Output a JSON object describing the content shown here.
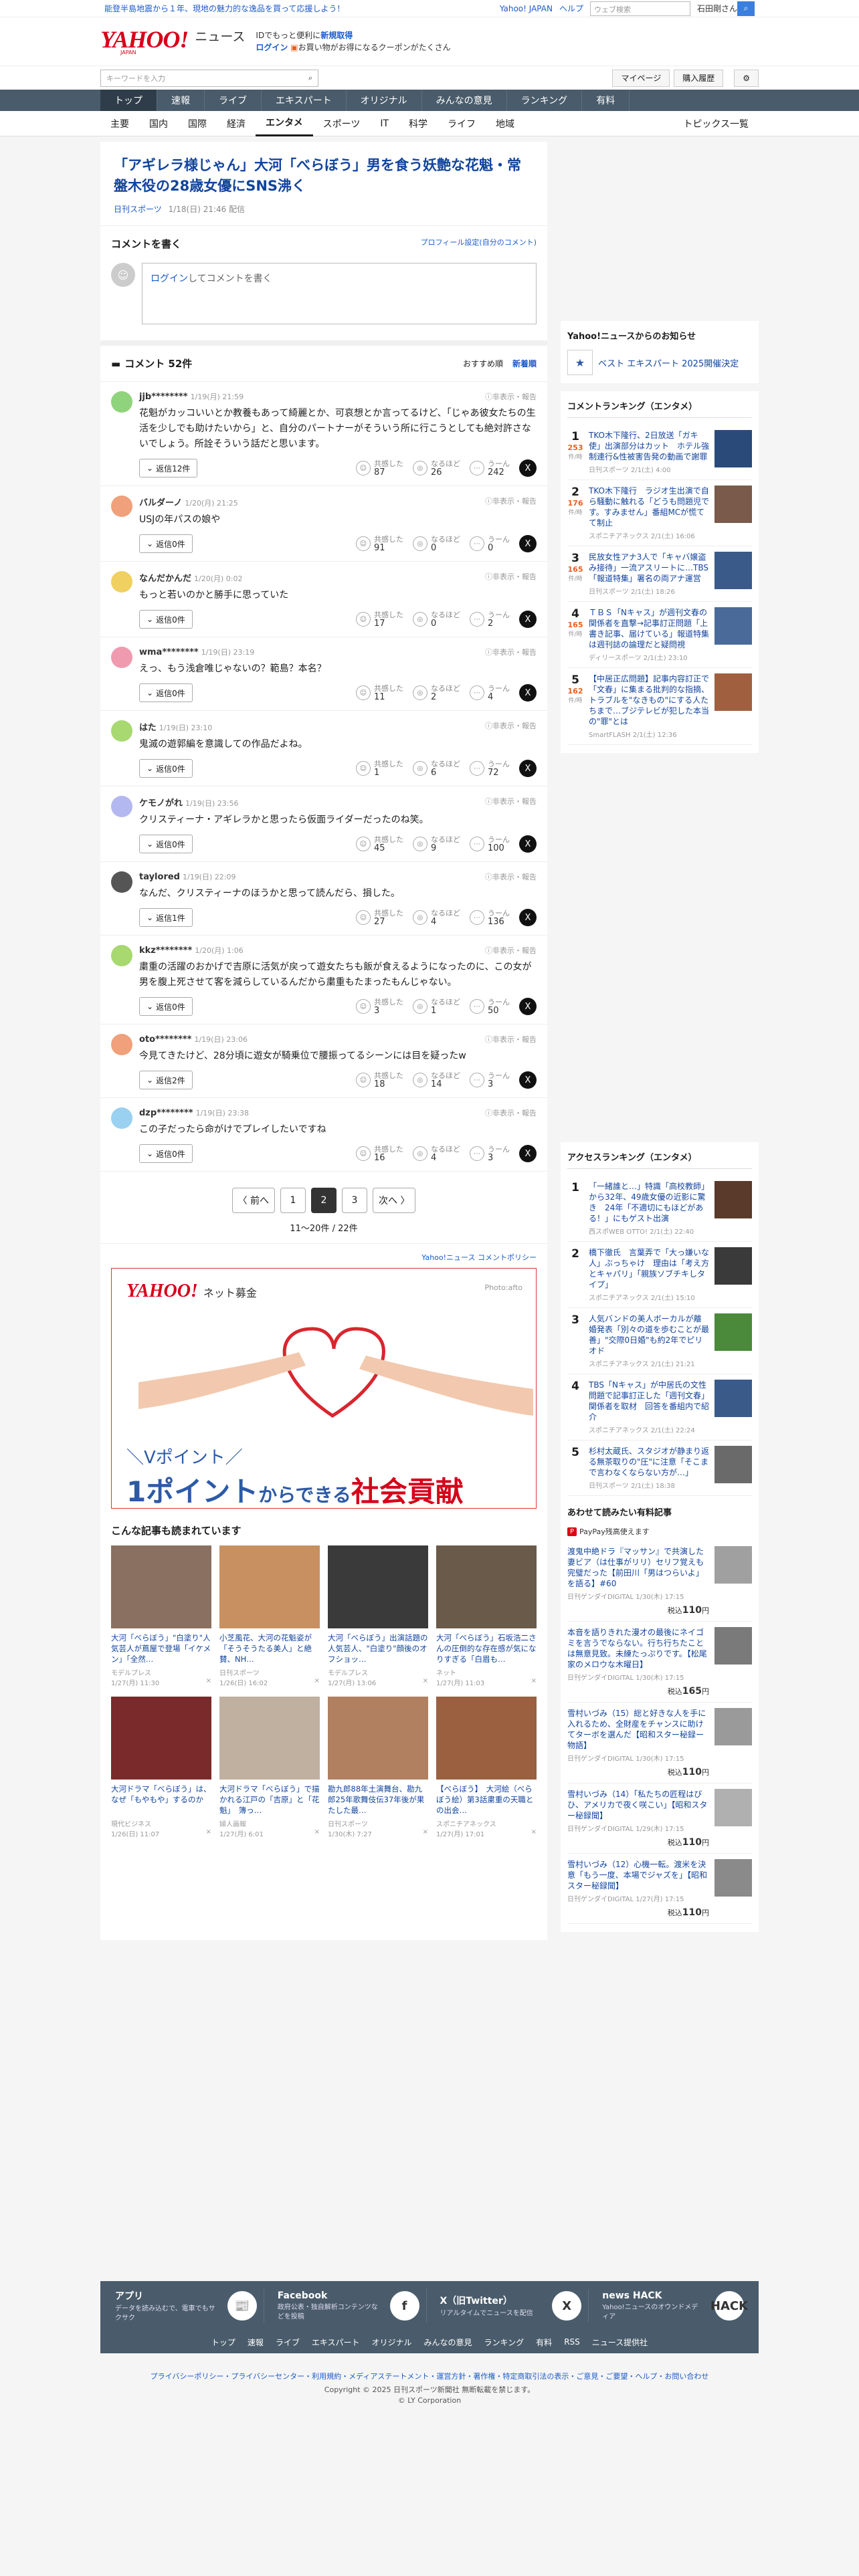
{
  "topbar": {
    "promo": "能登半島地震から１年、現地の魅力的な逸品を買って応援しよう！",
    "links": [
      "Yahoo! JAPAN",
      "ヘルプ"
    ],
    "search_placeholder": "ウェブ検索",
    "user": "石田剛さん"
  },
  "masthead": {
    "logo": "YAHOO!",
    "logo_sub": "JAPAN",
    "section": "ニュース",
    "promo_line1_pre": "IDでもっと便利に",
    "promo_line1_link": "新規取得",
    "promo_line2_link": "ログイン",
    "promo_line2_text": "お買い物がお得になるクーポンがたくさん"
  },
  "toolrow": {
    "keyword_placeholder": "キーワードを入力",
    "mypage": "マイページ",
    "history": "購入履歴"
  },
  "nav": [
    "トップ",
    "速報",
    "ライブ",
    "エキスパート",
    "オリジナル",
    "みんなの意見",
    "ランキング",
    "有料"
  ],
  "subnav": [
    "主要",
    "国内",
    "国際",
    "経済",
    "エンタメ",
    "スポーツ",
    "IT",
    "科学",
    "ライフ",
    "地域"
  ],
  "subnav_right": "トピックス一覧",
  "article": {
    "title": "「アギレラ様じゃん」大河「べらぼう」男を食う妖艶な花魁・常盤木役の28歳女優にSNS沸く",
    "source": "日刊スポーツ",
    "date": "1/18(日) 21:46 配信"
  },
  "comment_write": {
    "title": "コメントを書く",
    "profile_link": "プロフィール設定(自分のコメント)",
    "login": "ログイン",
    "placeholder": "してコメントを書く"
  },
  "comments_header": {
    "title": "コメント 52件",
    "sort_recommended": "おすすめ順",
    "sort_newest": "新着順"
  },
  "labels": {
    "hide_report": "非表示・報告",
    "agree": "共感した",
    "naruhodo": "なるほど",
    "uun": "うーん"
  },
  "comments": [
    {
      "user": "jjb********",
      "date": "1/19(月) 21:59",
      "text": "花魁がカッコいいとか教養もあって綺麗とか、可哀想とか言ってるけど、「じゃあ彼女たちの生活を少しでも助けたいから」と、自分のパートナーがそういう所に行こうとしても絶対許さないでしょう。所詮そういう話だと思います。",
      "reply": "返信12件",
      "agree": "87",
      "naruhodo": "26",
      "uun": "242",
      "color": "#8fd37c"
    },
    {
      "user": "バルダーノ",
      "date": "1/20(月) 21:25",
      "text": "USJの年パスの娘や",
      "reply": "返信0件",
      "agree": "91",
      "naruhodo": "0",
      "uun": "0",
      "color": "#f0a07a"
    },
    {
      "user": "なんだかんだ",
      "date": "1/20(月) 0:02",
      "text": "もっと若いのかと勝手に思っていた",
      "reply": "返信0件",
      "agree": "17",
      "naruhodo": "0",
      "uun": "2",
      "color": "#f0d060"
    },
    {
      "user": "wma********",
      "date": "1/19(日) 23:19",
      "text": "えっ、もう浅倉唯じゃないの？範島？本名？",
      "reply": "返信0件",
      "agree": "11",
      "naruhodo": "2",
      "uun": "4",
      "color": "#f09ab0"
    },
    {
      "user": "はた",
      "date": "1/19(日) 23:10",
      "text": "鬼滅の遊郭編を意識しての作品だよね。",
      "reply": "返信0件",
      "agree": "1",
      "naruhodo": "6",
      "uun": "72",
      "color": "#a8d870"
    },
    {
      "user": "ケモノがれ",
      "date": "1/19(日) 23:56",
      "text": "クリスティーナ・アギレラかと思ったら仮面ライダーだったのね笑。",
      "reply": "返信0件",
      "agree": "45",
      "naruhodo": "9",
      "uun": "100",
      "color": "#b4b8f0"
    },
    {
      "user": "taylored",
      "date": "1/19(日) 22:09",
      "text": "なんだ、クリスティーナのほうかと思って読んだら、損した。",
      "reply": "返信1件",
      "agree": "27",
      "naruhodo": "4",
      "uun": "136",
      "color": "#555555"
    },
    {
      "user": "kkz********",
      "date": "1/20(月) 1:06",
      "text": "粛重の活躍のおかげで吉原に活気が戻って遊女たちも飯が食えるようになったのに、この女が男を腹上死させて客を減らしているんだから粛重もたまったもんじゃない。",
      "reply": "返信0件",
      "agree": "3",
      "naruhodo": "1",
      "uun": "50",
      "color": "#a8d870"
    },
    {
      "user": "oto********",
      "date": "1/19(日) 23:06",
      "text": "今見てきたけど、28分頃に遊女が騎乗位で腰振ってるシーンには目を疑ったw",
      "reply": "返信2件",
      "agree": "18",
      "naruhodo": "14",
      "uun": "3",
      "color": "#f0a07a"
    },
    {
      "user": "dzp********",
      "date": "1/19(日) 23:38",
      "text": "この子だったら命がけでプレイしたいですね",
      "reply": "返信0件",
      "agree": "16",
      "naruhodo": "4",
      "uun": "3",
      "color": "#9ad0f0"
    }
  ],
  "pager": {
    "prev": "〈 前へ",
    "pages": [
      "1",
      "2",
      "3"
    ],
    "current": "2",
    "next": "次へ 〉",
    "info": "11〜20件 / 22件"
  },
  "comment_policy": "Yahoo!ニュース コメントポリシー",
  "ad": {
    "logo": "YAHOO!",
    "label": "ネット募金",
    "photo_credit": "Photo:afto",
    "line1": "＼Vポイント／",
    "line2_a": "1ポイント",
    "line2_b": "からできる",
    "line2_c": "社会貢献"
  },
  "also_read": {
    "title": "こんな記事も読まれています",
    "items": [
      {
        "title": "大河「べらぼう」\"白塗り\"人気芸人が蔦屋で登場「イケメン」「全然…",
        "source": "モデルプレス",
        "date": "1/27(月) 11:30"
      },
      {
        "title": "小芝風花、大河の花魁姿が「そうそうたる美人」と絶賛、NH…",
        "source": "日刊スポーツ",
        "date": "1/26(日) 16:02"
      },
      {
        "title": "大河「べらぼう」出演話題の人気芸人、\"白塗り\"顔後のオフショッ…",
        "source": "モデルプレス",
        "date": "1/27(月) 13:06"
      },
      {
        "title": "大河「べらぼう」石坂浩二さんの圧倒的な存在感が気になりすぎる「白眉も…",
        "source": "ネット",
        "date": "1/27(月) 11:03"
      },
      {
        "title": "大河ドラマ「べらぼう」は、なぜ「もやもや」するのか",
        "source": "現代ビジネス",
        "date": "1/26(日) 11:07"
      },
      {
        "title": "大河ドラマ「べらぼう」で描かれる江戸の「吉原」と「花魁」　簿っ…",
        "source": "婦人画報",
        "date": "1/27(月) 6:01"
      },
      {
        "title": "勘九郎88年土演舞台、勘九郎25年歌舞伎伝37年後が果たした最…",
        "source": "日刊スポーツ",
        "date": "1/30(木) 7:27"
      },
      {
        "title": "【べらぼう】　大河絵（べらぼう絵）第3話粛重の天職との出会…",
        "source": "スポニチアネックス",
        "date": "1/27(月) 17:01"
      }
    ]
  },
  "sidebar": {
    "notice_title": "Yahoo!ニュースからのお知らせ",
    "notice_item": "ベスト エキスパート 2025開催決定",
    "comment_ranking_title": "コメントランキング（エンタメ）",
    "comment_ranking": [
      {
        "rank": "1",
        "count": "253",
        "unit": "件/時",
        "title": "TKO木下隆行、2日放送「ガキ使」出演部分はカット　ホテル強制連行&性被害告発の動画で謝罪",
        "source": "日刊スポーツ 2/1(土) 4:00"
      },
      {
        "rank": "2",
        "count": "176",
        "unit": "件/時",
        "title": "TKO木下隆行　ラジオ生出演で自ら騒動に触れる「どうも問題児です。すみません」番組MCが慌てて制止",
        "source": "スポニチアネックス 2/1(土) 16:06"
      },
      {
        "rank": "3",
        "count": "165",
        "unit": "件/時",
        "title": "民放女性アナ3人で「キャバ嬢盗み接待」一流アスリートに…TBS「報道特集」署名の両アナ運営",
        "source": "日刊スポーツ 2/1(土) 18:26"
      },
      {
        "rank": "4",
        "count": "165",
        "unit": "件/時",
        "title": "ＴＢＳ「Nキャス」が週刊文春の関係者を直撃→記事訂正問題「上書き記事、届けている」報道特集は週刊誌の論理だと疑問視",
        "source": "ディリースポーツ 2/1(土) 23:10"
      },
      {
        "rank": "5",
        "count": "162",
        "unit": "件/時",
        "title": "【中居正広問題】記事内容訂正で「文春」に集まる批判的な指摘、トラブルを\"なきもの\"にする人たちまで…ブジテレビが犯した本当の\"罪\"とは",
        "source": "SmartFLASH 2/1(土) 12:36"
      }
    ],
    "access_ranking_title": "アクセスランキング（エンタメ）",
    "access_ranking": [
      {
        "rank": "1",
        "title": "「一緒誰と…」特識「高校教師」から32年、49歳女優の近影に驚き　24年「不適切にもほどがある！」にもゲスト出演",
        "source": "西スポWEB OTTO! 2/1(土) 22:40"
      },
      {
        "rank": "2",
        "title": "橋下徹氏　言葉弄で「大っ嫌いな人」ぶっちゃけ　理由は「考え方とキャパリ」「親族ソブチキしタイプ」",
        "source": "スポニチアネックス 2/1(土) 15:10"
      },
      {
        "rank": "3",
        "title": "人気バンドの美人ボーカルが離婚発表「別々の道を歩むことが最善」\"交際0日婚\"も約2年でピリオド",
        "source": "スポニチアネックス 2/1(土) 21:21"
      },
      {
        "rank": "4",
        "title": "TBS「Nキャス」が中居氏の文性問題で記事訂正した「週刊文春」関係者を取材　回答を番組内で紹介",
        "source": "スポニチアネックス 2/1(土) 22:24"
      },
      {
        "rank": "5",
        "title": "杉村太蔵氏、スタジオが静まり返る無茶取りの\"圧\"に注意「そこまで言わなくならない方が…」",
        "source": "日刊スポーツ 2/1(土) 18:38"
      }
    ],
    "paid_title": "あわせて読みたい有料記事",
    "paypay": "PayPay残高使えます",
    "paid": [
      {
        "title": "渡鬼中絶ドラ『マッサン』で共演した妻ビア（は仕事がリリ）セリフ覚えも完璧だった【前田川「男はつらいよ」を語る】#60",
        "source": "日刊ゲンダイDIGITAL 1/30(木) 17:15",
        "price": "110"
      },
      {
        "title": "本音を語りきれた漫才の最後にネイゴミを言うでならない。行ち行ちたことは無意見致。未練たっぷりです。【松尾家のメロウな木曜日】",
        "source": "日刊ゲンダイDIGITAL 1/30(木) 17:15",
        "price": "165"
      },
      {
        "title": "雪村いづみ（15）総と好きな人を手に入れるため、全財産をチャンスに助けてターボを選んだ【昭和スター秘録ー物語】",
        "source": "日刊ゲンダイDIGITAL 1/30(木) 17:15",
        "price": "110"
      },
      {
        "title": "雪村いづみ（14）「私たちの匠程はびひ、アメリカで夜く咲こい」【昭和スター秘録聞】",
        "source": "日刊ゲンダイDIGITAL 1/29(木) 17:15",
        "price": "110"
      },
      {
        "title": "雪村いづみ（12）心機一転。渡米を決意「もう一度、本場でジャズを」【昭和スター秘録聞】",
        "source": "日刊ゲンダイDIGITAL 1/27(月) 17:15",
        "price": "110"
      }
    ],
    "price_prefix": "税込",
    "price_suffix": "円"
  },
  "footer": {
    "apps": [
      {
        "title": "アプリ",
        "desc": "データを読み込むで、電車でもサクサク",
        "icon": "📰"
      },
      {
        "title": "Facebook",
        "desc": "政府公表・独自解析コンテンツなどを投稿",
        "icon": "f"
      },
      {
        "title": "X（旧Twitter）",
        "desc": "リアルタイムでニュースを配信",
        "icon": "X"
      },
      {
        "title": "news HACK",
        "desc": "Yahoo!ニュースのオウンドメディア",
        "icon": "HACK"
      }
    ],
    "nav": [
      "トップ",
      "速報",
      "ライブ",
      "エキスパート",
      "オリジナル",
      "みんなの意見",
      "ランキング",
      "有料",
      "RSS",
      "ニュース提供社"
    ],
    "links": "プライバシーポリシー・プライバシーセンター・利用規約・メディアステートメント・運営方針・著作権・特定商取引法の表示・ご意見・ご要望・ヘルプ・お問い合わせ",
    "copyright": "Copyright © 2025 日刊スポーツ新聞社 無断転載を禁じます。",
    "corp": "© LY Corporation"
  }
}
